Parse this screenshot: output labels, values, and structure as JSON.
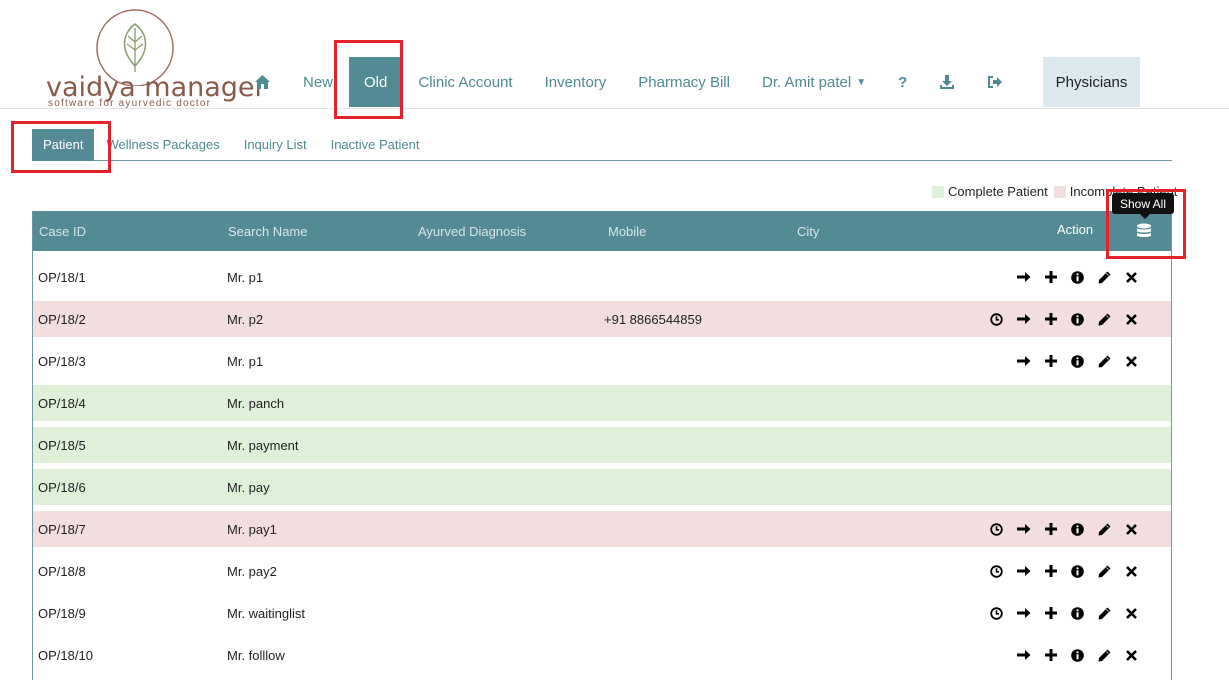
{
  "logo": {
    "name": "vaidya manager",
    "tagline": "software for ayurvedic doctor"
  },
  "nav": {
    "home_icon": "home-icon",
    "items": [
      "New",
      "Old",
      "Clinic Account",
      "Inventory",
      "Pharmacy Bill"
    ],
    "active": "Old",
    "user": "Dr. Amit patel",
    "help_label": "?",
    "download_icon": "download-icon",
    "logout_icon": "logout-icon",
    "physicians": "Physicians"
  },
  "subtabs": {
    "items": [
      "Patient",
      "Wellness Packages",
      "Inquiry List",
      "Inactive Patient"
    ],
    "active": "Patient"
  },
  "legend": {
    "complete": "Complete Patient",
    "incomplete": "Incomplete Patient"
  },
  "tooltip": {
    "show_all": "Show All"
  },
  "table": {
    "headers": {
      "case_id": "Case ID",
      "search_name": "Search Name",
      "diagnosis": "Ayurved Diagnosis",
      "mobile": "Mobile",
      "city": "City",
      "action": "Action"
    },
    "rows": [
      {
        "case_id": "OP/18/1",
        "name": "Mr. p1",
        "mobile": "",
        "status": "none",
        "actions": [
          "arrow",
          "plus",
          "info",
          "edit",
          "delete"
        ]
      },
      {
        "case_id": "OP/18/2",
        "name": "Mr. p2",
        "mobile": "+91 8866544859",
        "status": "incomplete",
        "actions": [
          "clock",
          "arrow",
          "plus",
          "info",
          "edit",
          "delete"
        ]
      },
      {
        "case_id": "OP/18/3",
        "name": "Mr. p1",
        "mobile": "",
        "status": "none",
        "actions": [
          "arrow",
          "plus",
          "info",
          "edit",
          "delete"
        ]
      },
      {
        "case_id": "OP/18/4",
        "name": "Mr. panch",
        "mobile": "",
        "status": "complete",
        "actions": []
      },
      {
        "case_id": "OP/18/5",
        "name": "Mr. payment",
        "mobile": "",
        "status": "complete",
        "actions": []
      },
      {
        "case_id": "OP/18/6",
        "name": "Mr. pay",
        "mobile": "",
        "status": "complete",
        "actions": []
      },
      {
        "case_id": "OP/18/7",
        "name": "Mr. pay1",
        "mobile": "",
        "status": "incomplete",
        "actions": [
          "clock",
          "arrow",
          "plus",
          "info",
          "edit",
          "delete"
        ]
      },
      {
        "case_id": "OP/18/8",
        "name": "Mr. pay2",
        "mobile": "",
        "status": "none",
        "actions": [
          "clock",
          "arrow",
          "plus",
          "info",
          "edit",
          "delete"
        ]
      },
      {
        "case_id": "OP/18/9",
        "name": "Mr. waitinglist",
        "mobile": "",
        "status": "none",
        "actions": [
          "clock",
          "arrow",
          "plus",
          "info",
          "edit",
          "delete"
        ]
      },
      {
        "case_id": "OP/18/10",
        "name": "Mr. folllow",
        "mobile": "",
        "status": "none",
        "actions": [
          "arrow",
          "plus",
          "info",
          "edit",
          "delete"
        ]
      }
    ]
  },
  "colors": {
    "teal": "#548a93",
    "complete": "#dff0d8",
    "incomplete": "#f2dede",
    "highlight": "#e8202a"
  }
}
